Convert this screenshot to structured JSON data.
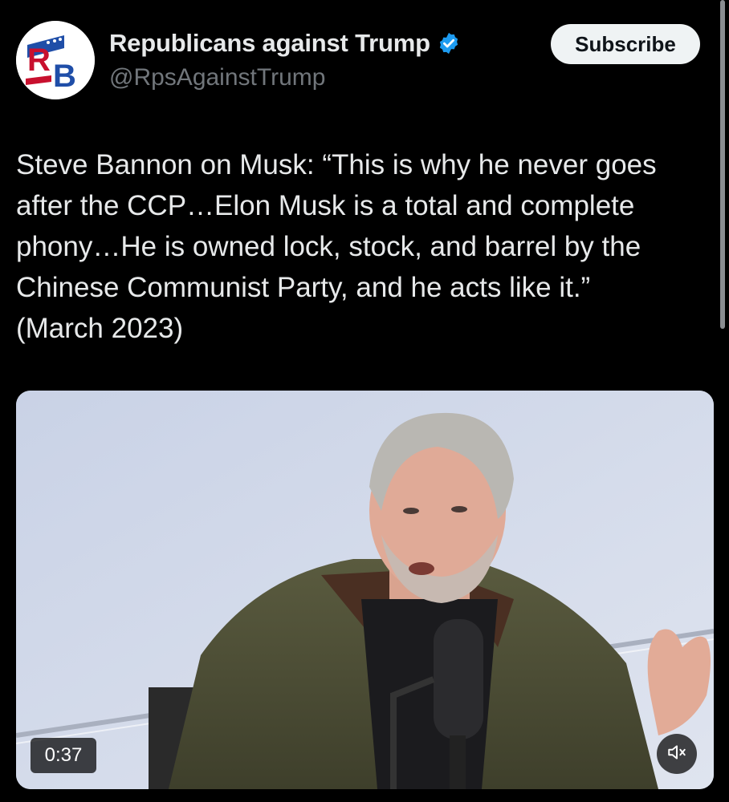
{
  "post": {
    "author": {
      "display_name": "Republicans against Trump",
      "handle": "@RpsAgainstTrump",
      "verified": true,
      "avatar_initials": "RB"
    },
    "subscribe_label": "Subscribe",
    "text": "Steve Bannon on Musk: “This is why he never goes after the CCP…Elon Musk is a total and complete phony…He is owned lock, stock, and barrel by the Chinese Communist Party, and he acts like it.”\n(March 2023)",
    "media": {
      "type": "video",
      "duration": "0:37",
      "muted": true
    }
  },
  "colors": {
    "background": "#000000",
    "text": "#e7e9ea",
    "secondary": "#71767b",
    "verified_badge": "#1d9bf0",
    "subscribe_bg": "#eff3f4"
  },
  "icons": {
    "verified": "verified-badge-icon",
    "mute": "speaker-muted-icon"
  }
}
